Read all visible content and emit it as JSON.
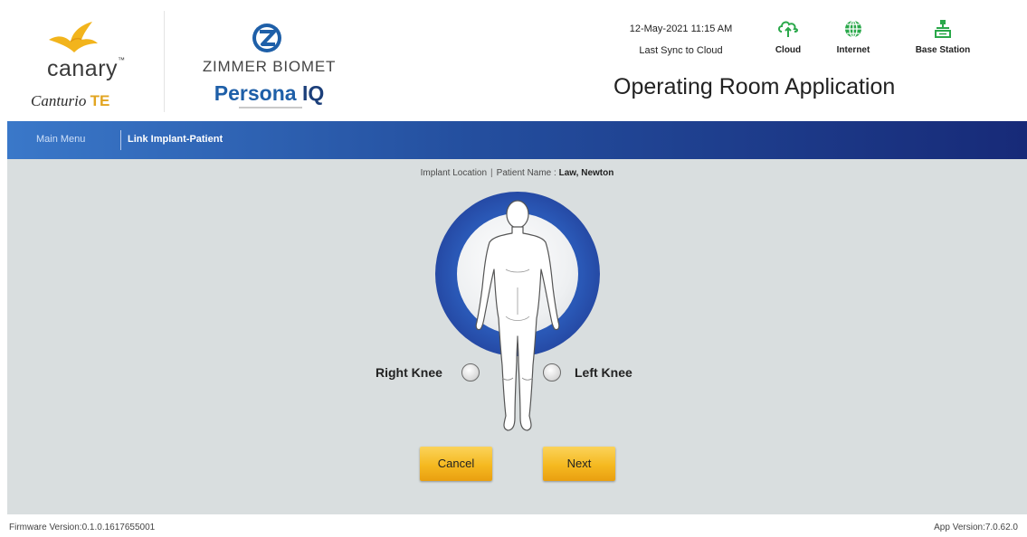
{
  "header": {
    "canary_brand": "canary",
    "canturio_brand": "Canturio",
    "canturio_suffix": "TE",
    "zimmer_brand": "ZIMMER BIOMET",
    "persona_brand": "Persona",
    "persona_suffix": "IQ",
    "sync_datetime": "12-May-2021 11:15 AM",
    "sync_label": "Last Sync to Cloud",
    "app_title": "Operating Room Application",
    "status": {
      "cloud_label": "Cloud",
      "internet_label": "Internet",
      "base_station_label": "Base Station"
    },
    "colors": {
      "status_green": "#2aa84a",
      "brand_yellow": "#f2b41c",
      "brand_blue": "#1e5fa8"
    }
  },
  "nav": {
    "main_menu": "Main Menu",
    "current_page": "Link Implant-Patient",
    "colors": {
      "start": "#3a78c9",
      "end": "#172a78"
    }
  },
  "main": {
    "crumb_location": "Implant Location",
    "crumb_patient_label": "Patient Name :",
    "crumb_patient_name": "Law, Newton",
    "right_knee_label": "Right Knee",
    "left_knee_label": "Left Knee",
    "cancel_label": "Cancel",
    "next_label": "Next"
  },
  "footer": {
    "firmware_version": "Firmware Version:0.1.0.1617655001",
    "app_version": "App Version:7.0.62.0"
  }
}
